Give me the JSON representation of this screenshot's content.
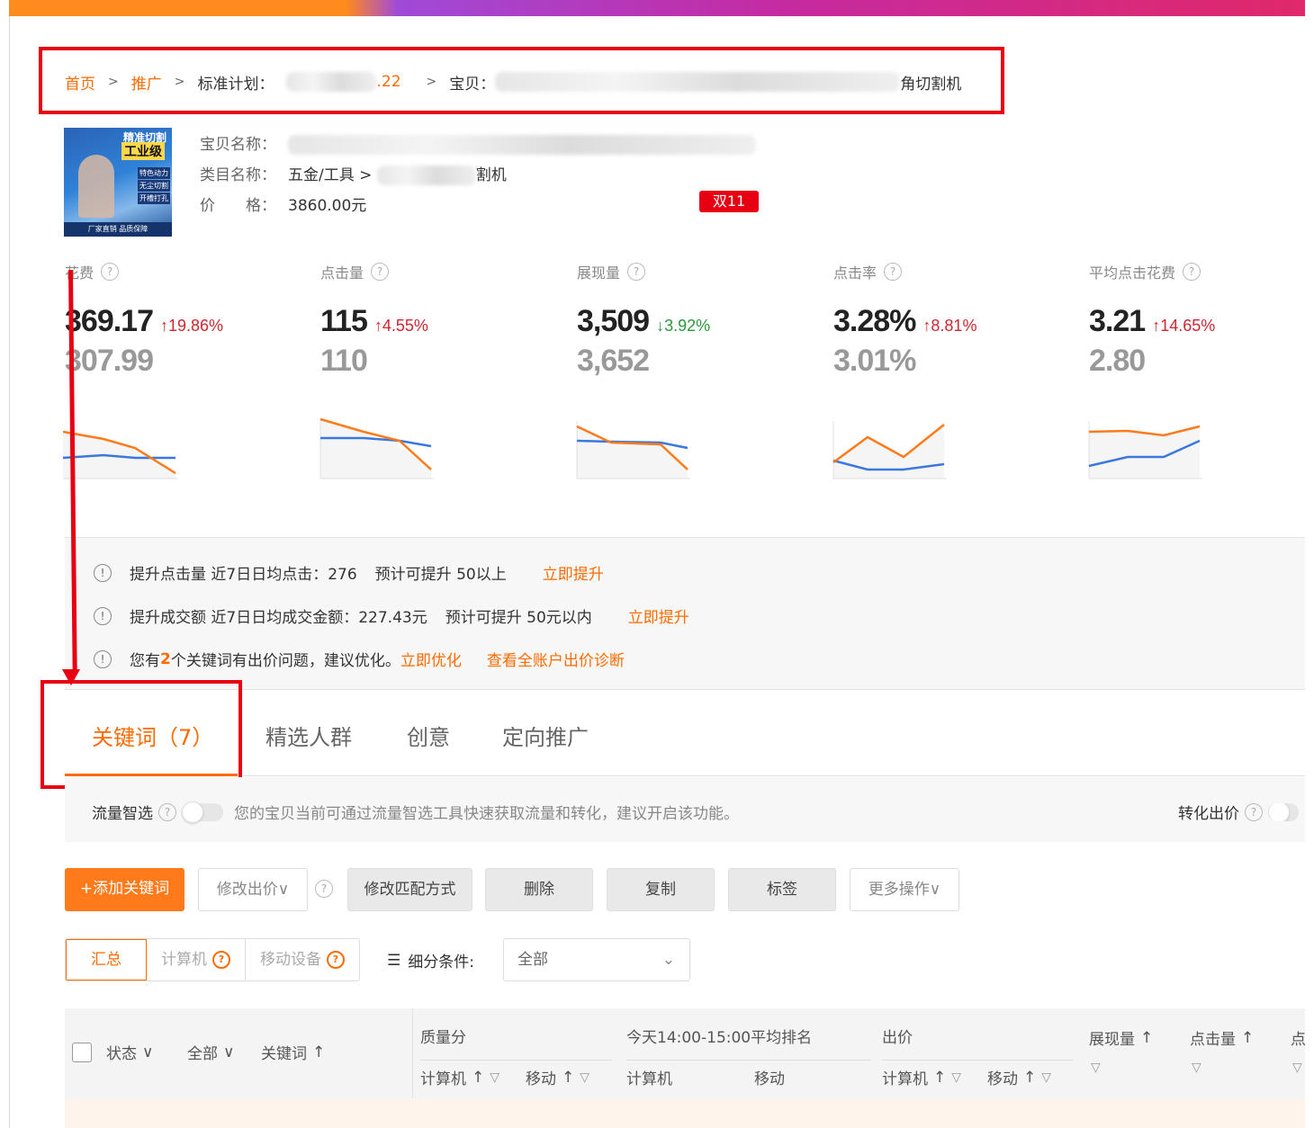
{
  "breadcrumb": {
    "home": "首页",
    "promo": "推广",
    "plan_label": "标准计划：",
    "plan_suffix": ".22",
    "item_label": "宝贝：",
    "item_suffix": "角切割机"
  },
  "product": {
    "image_text_top": "精准切割",
    "image_text_main": "工业级",
    "image_badges": [
      "特色动力",
      "无尘切割",
      "开槽打孔"
    ],
    "image_footer": "厂家直销 品质保障",
    "name_label": "宝贝名称：",
    "name_value": "",
    "category_label": "类目名称：",
    "category_value_prefix": "五金/工具 > ",
    "category_value_suffix": "割机",
    "price_label": "价　　格：",
    "price_value": "3860.00元",
    "tag": "双11"
  },
  "metrics": [
    {
      "label": "花费",
      "value": "369.17",
      "change": "↑19.86%",
      "direction": "up",
      "prev": "307.99"
    },
    {
      "label": "点击量",
      "value": "115",
      "change": "↑4.55%",
      "direction": "up",
      "prev": "110"
    },
    {
      "label": "展现量",
      "value": "3,509",
      "change": "↓3.92%",
      "direction": "down",
      "prev": "3,652"
    },
    {
      "label": "点击率",
      "value": "3.28%",
      "change": "↑8.81%",
      "direction": "up",
      "prev": "3.01%"
    },
    {
      "label": "平均点击花费",
      "value": "3.21",
      "change": "↑14.65%",
      "direction": "up",
      "prev": "2.80"
    }
  ],
  "colors": {
    "accent": "#ff6a00",
    "up": "#d0262d",
    "down": "#2a9a3a",
    "annotation": "#e60012",
    "line_blue": "#3a78e0",
    "line_orange": "#ff7a1a"
  },
  "suggestions": {
    "row1_title": "提升点击量",
    "row1_text": "近7日日均点击：276",
    "row1_predict": "预计可提升 50以上",
    "row1_action": "立即提升",
    "row2_title": "提升成交额",
    "row2_text": "近7日日均成交金额：227.43元",
    "row2_predict": "预计可提升 50元以内",
    "row2_action": "立即提升",
    "row3_text_a": "您有",
    "row3_count": "2",
    "row3_text_b": "个关键词有出价问题，建议优化。",
    "row3_action": "立即优化",
    "row3_link": "查看全账户出价诊断"
  },
  "tabs": [
    {
      "label": "关键词（7）"
    },
    {
      "label": "精选人群"
    },
    {
      "label": "创意"
    },
    {
      "label": "定向推广"
    }
  ],
  "flowbar": {
    "title": "流量智选",
    "hint": "您的宝贝当前可通过流量智选工具快速获取流量和转化，建议开启该功能。",
    "right_label": "转化出价"
  },
  "toolbar": {
    "add": "+添加关键词",
    "modify_bid": "修改出价∨",
    "modify_match": "修改匹配方式",
    "delete": "删除",
    "copy": "复制",
    "label": "标签",
    "more": "更多操作∨"
  },
  "filters": {
    "summary": "汇总",
    "pc": "计算机",
    "mobile": "移动设备",
    "sub_condition": "细分条件:",
    "select_value": "全部"
  },
  "table_header": {
    "status": "状态",
    "all": "全部",
    "keyword": "关键词",
    "quality": "质量分",
    "rank_title": "今天14:00-15:00平均排名",
    "bid": "出价",
    "impressions": "展现量",
    "clicks": "点击量",
    "more": "点",
    "pc": "计算机",
    "mobile": "移动"
  }
}
